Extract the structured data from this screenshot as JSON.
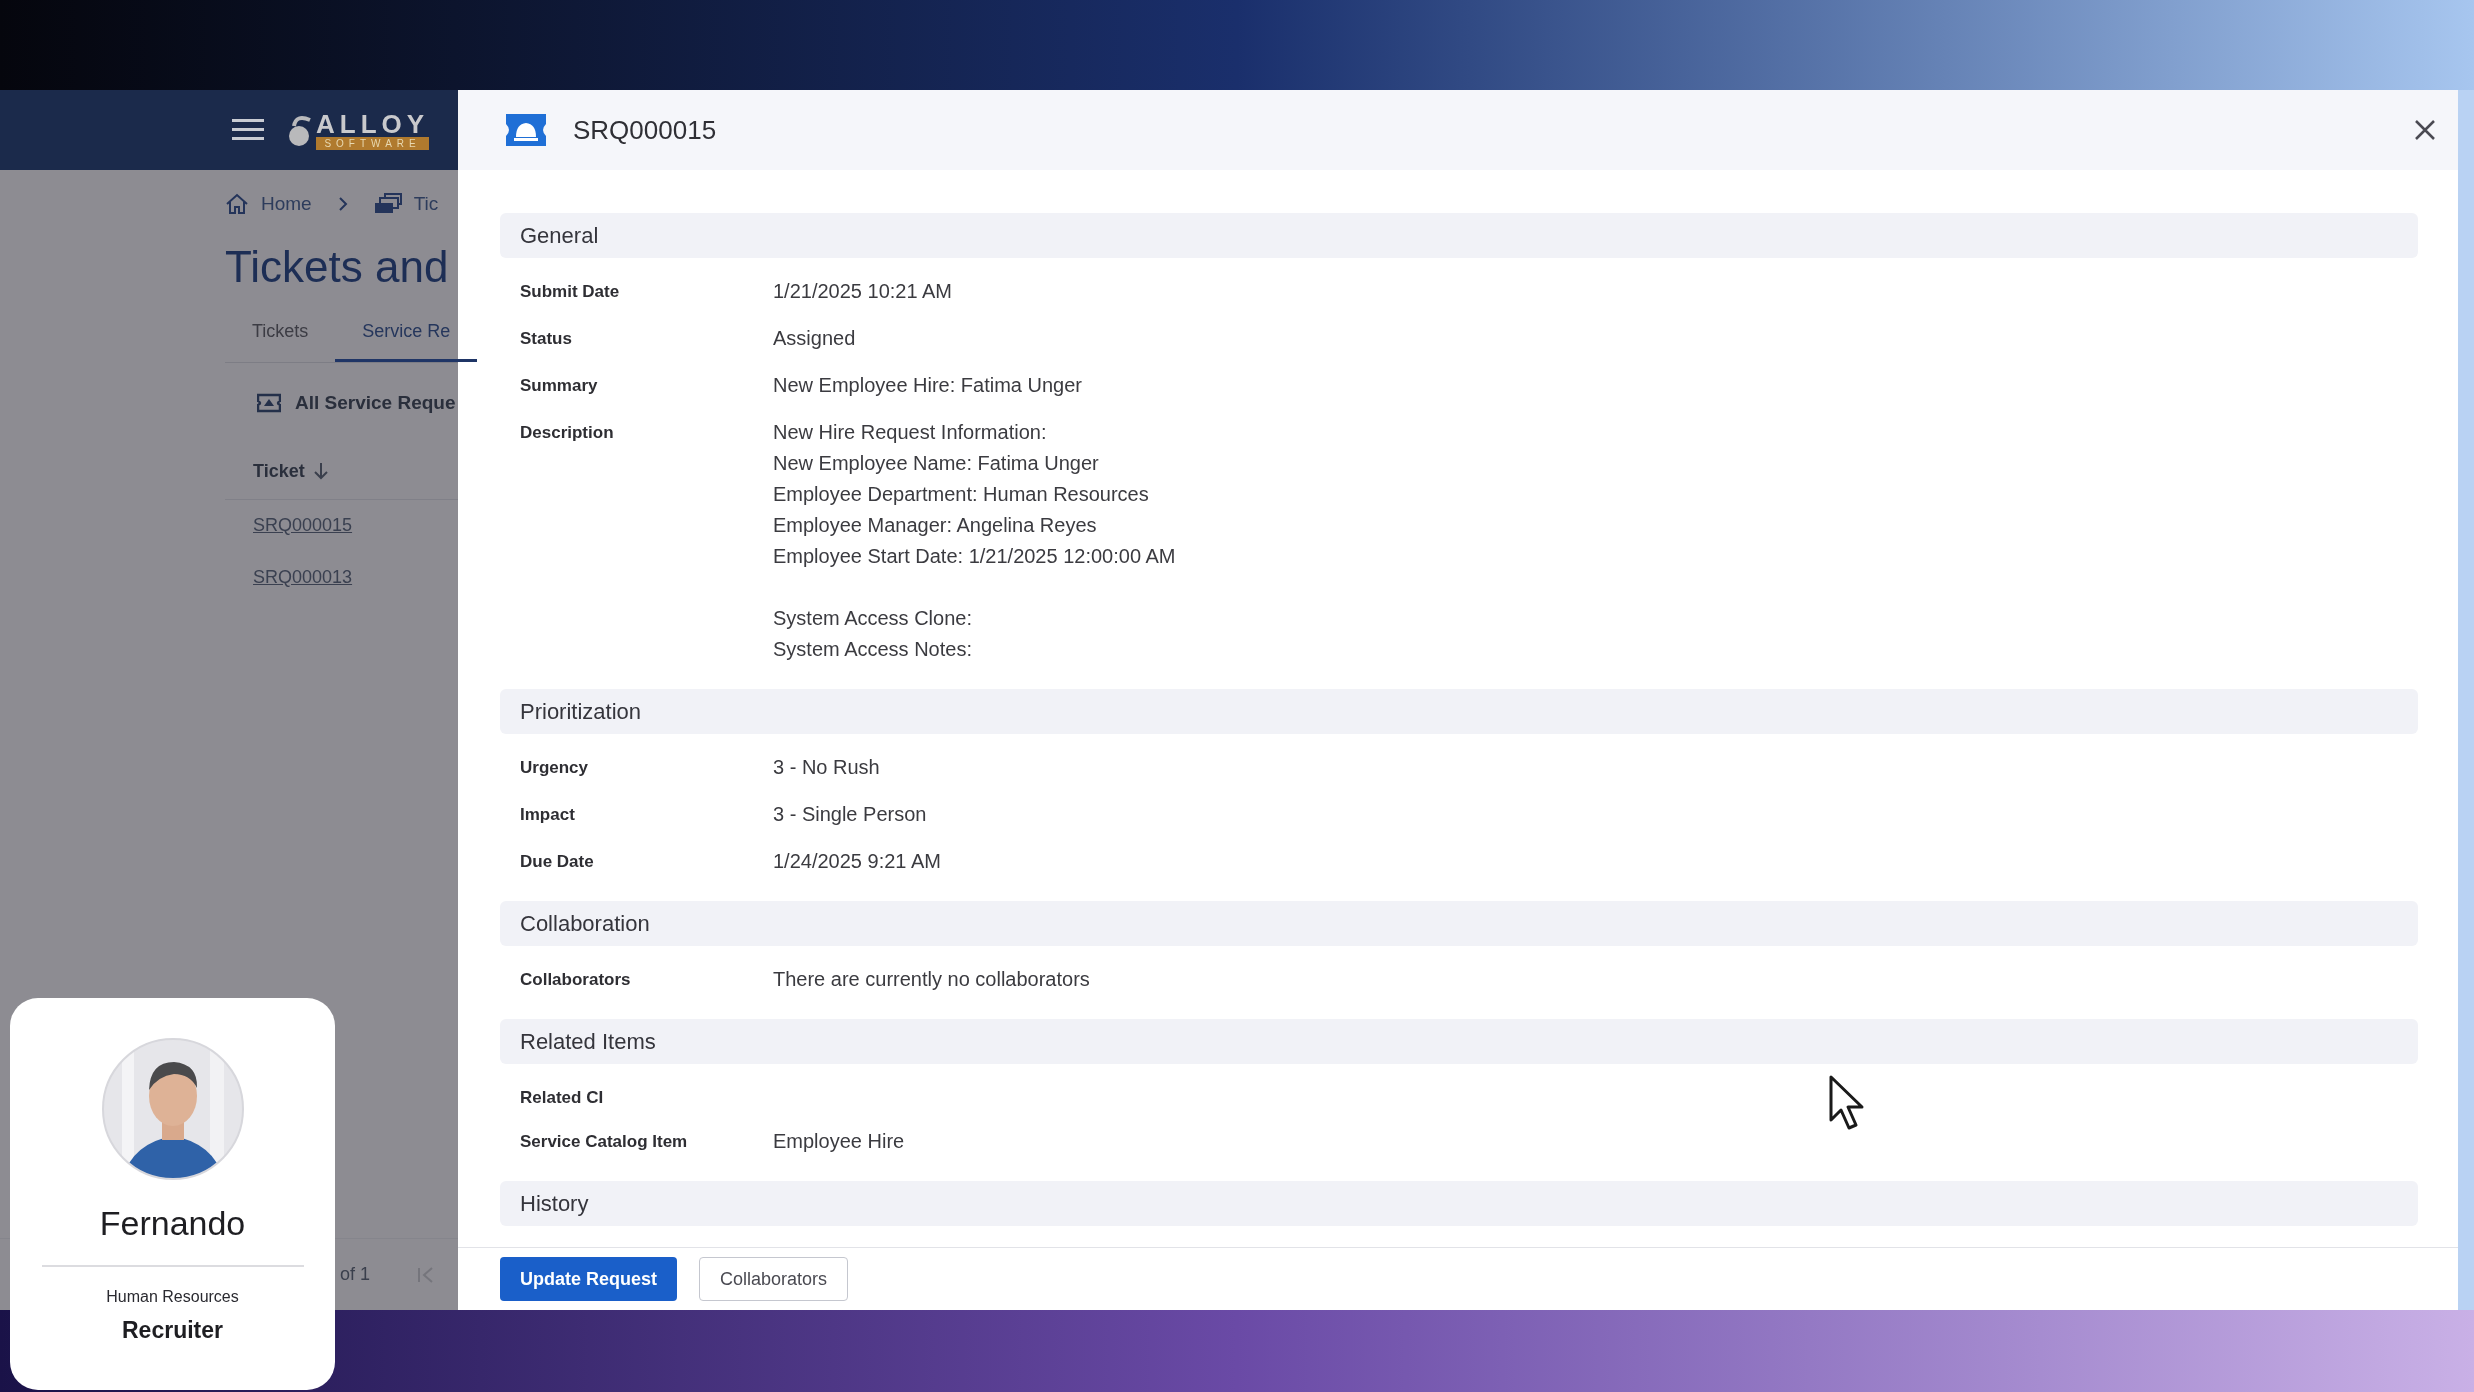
{
  "background_app": {
    "logo": {
      "word": "ALLOY",
      "subword": "SOFTWARE"
    },
    "breadcrumb": [
      {
        "label": "Home",
        "kind": "home"
      },
      {
        "label": "Tic",
        "kind": "tickets"
      }
    ],
    "page_title": "Tickets and",
    "tabs": [
      {
        "label": "Tickets",
        "selected": false
      },
      {
        "label": "Service Re",
        "selected": true
      }
    ],
    "view": "All Service Reque",
    "table": {
      "columns": [
        {
          "label": "Ticket",
          "sort_descending": true
        }
      ],
      "rows": [
        "SRQ000015",
        "SRQ000013"
      ]
    },
    "pagination": {
      "page_count": "of 1"
    }
  },
  "dialog": {
    "title": "SRQ000015",
    "sections": [
      {
        "title": "General",
        "fields": [
          {
            "label": "Submit Date",
            "value": "1/21/2025 10:21 AM"
          },
          {
            "label": "Status",
            "value": "Assigned"
          },
          {
            "label": "Summary",
            "value": "New Employee Hire: Fatima Unger"
          },
          {
            "label": "Description",
            "paragraphs": [
              [
                "New Hire Request Information:",
                "New Employee Name: Fatima Unger",
                "Employee Department: Human Resources",
                "Employee Manager: Angelina Reyes",
                "Employee Start Date: 1/21/2025 12:00:00 AM"
              ],
              [
                "System Access Clone:",
                "System Access Notes:"
              ]
            ]
          }
        ]
      },
      {
        "title": "Prioritization",
        "fields": [
          {
            "label": "Urgency",
            "value": "3 - No Rush"
          },
          {
            "label": "Impact",
            "value": "3 - Single Person"
          },
          {
            "label": "Due Date",
            "value": "1/24/2025 9:21 AM"
          }
        ]
      },
      {
        "title": "Collaboration",
        "fields": [
          {
            "label": "Collaborators",
            "value": "There are currently no collaborators"
          }
        ]
      },
      {
        "title": "Related Items",
        "fields": [
          {
            "label": "Related CI"
          },
          {
            "label": "Service Catalog Item",
            "value": "Employee Hire"
          }
        ]
      },
      {
        "title": "History"
      }
    ],
    "buttons": [
      {
        "label": "Update Request",
        "kind": "primary"
      },
      {
        "label": "Collaborators",
        "kind": "secondary"
      }
    ]
  },
  "profile_card": {
    "name": "Fernando",
    "department": "Human Resources",
    "role": "Recruiter"
  }
}
